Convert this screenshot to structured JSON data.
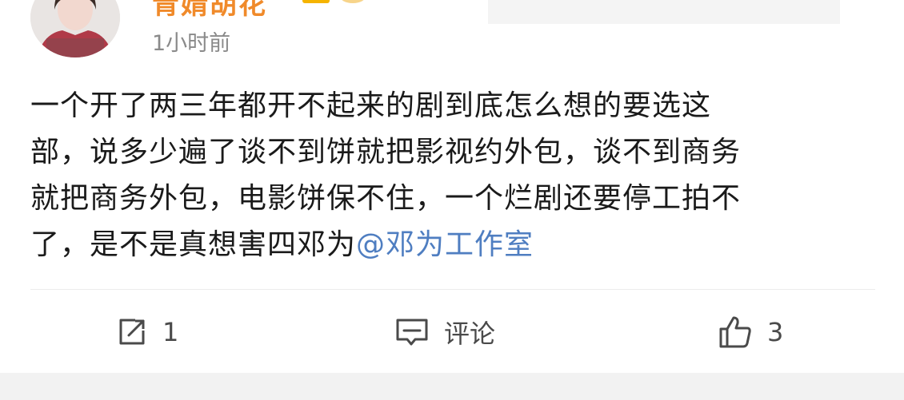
{
  "post": {
    "author": {
      "name": "青婧胡花"
    },
    "timestamp": "1小时前",
    "content": {
      "lines": [
        "一个开了两三年都开不起来的剧到底怎么想的要选这",
        "部，说多少遍了谈不到饼就把影视约外包，谈不到商务",
        "就把商务外包，电影饼保不住，一个烂剧还要停工拍不"
      ],
      "last_line_text": "了，是不是真想害四邓为",
      "mention": "@邓为工作室"
    },
    "actions": {
      "repost": {
        "icon": "share-icon",
        "count": "1"
      },
      "comment": {
        "icon": "comment-icon",
        "label": "评论"
      },
      "like": {
        "icon": "thumbs-up-icon",
        "count": "3"
      }
    },
    "colors": {
      "username": "#f08a2a",
      "mention": "#4f7ec1",
      "timestamp": "#8a8a8a",
      "text": "#1a1a1a",
      "action": "#4a4a4a"
    }
  }
}
